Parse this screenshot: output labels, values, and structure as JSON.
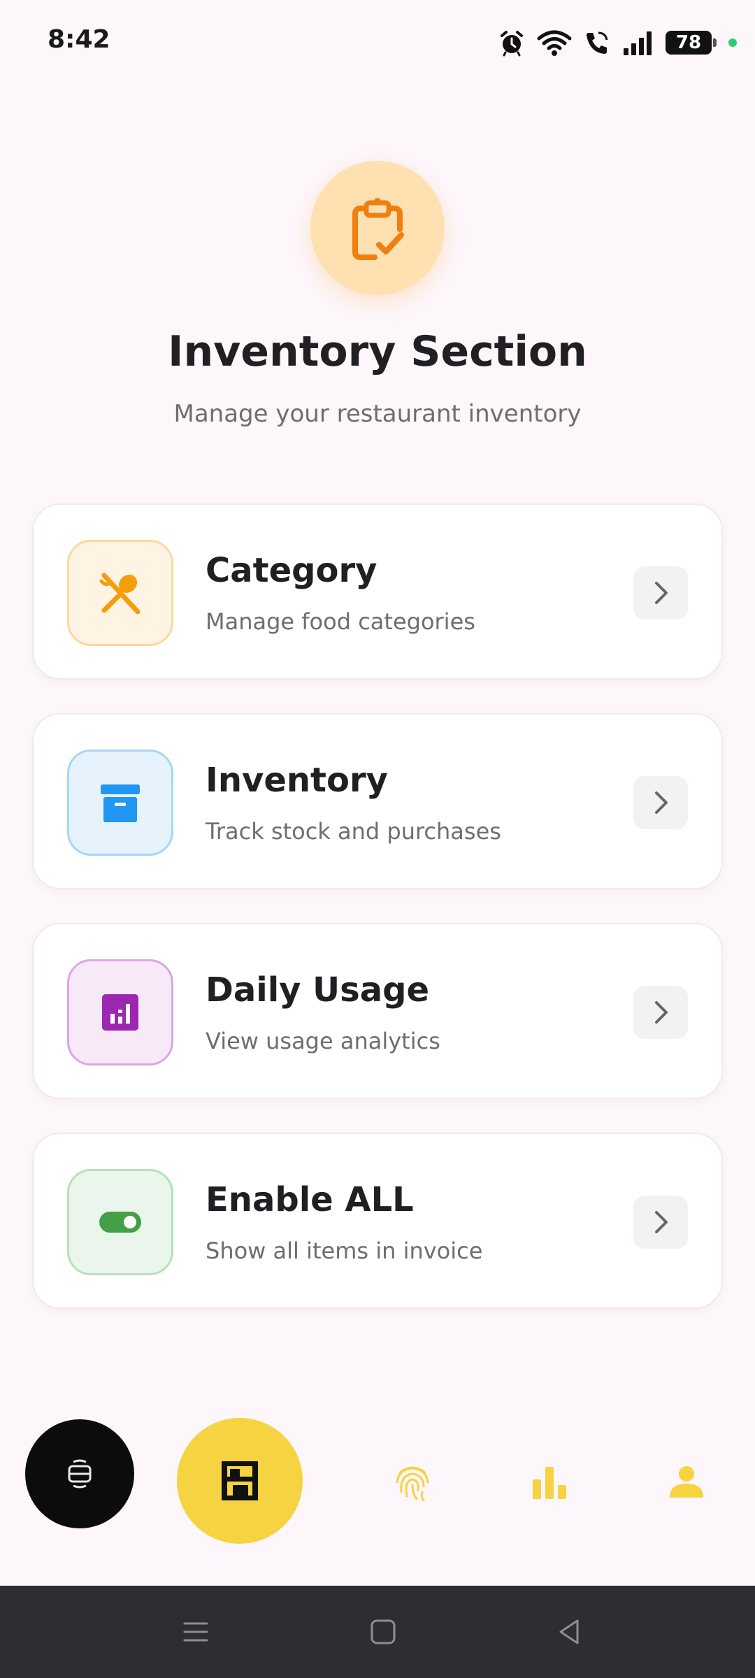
{
  "status_bar": {
    "time": "8:42",
    "battery": "78",
    "icons": [
      "alarm-icon",
      "wifi-icon",
      "wifi-call-icon",
      "signal-icon",
      "battery-icon"
    ]
  },
  "header": {
    "icon": "clipboard-check-icon",
    "title": "Inventory Section",
    "subtitle": "Manage your restaurant inventory"
  },
  "menu": [
    {
      "title": "Category",
      "description": "Manage food categories",
      "icon": "fork-spoon-icon",
      "accent": "#f59e0b",
      "bg": "#fff4e3",
      "border": "#fbd9a0"
    },
    {
      "title": "Inventory",
      "description": "Track stock and purchases",
      "icon": "archive-box-icon",
      "accent": "#2196f3",
      "bg": "#e6f3fd",
      "border": "#a9d5f5"
    },
    {
      "title": "Daily Usage",
      "description": "View usage analytics",
      "icon": "analytics-icon",
      "accent": "#9c27b0",
      "bg": "#f7e9f8",
      "border": "#dca6e3"
    },
    {
      "title": "Enable ALL",
      "description": "Show all items in invoice",
      "icon": "toggle-on-icon",
      "accent": "#43a047",
      "bg": "#eaf6eb",
      "border": "#b7e0ba"
    }
  ],
  "bottom_nav": {
    "items": [
      "scan-icon",
      "shelves-icon",
      "fingerprint-icon",
      "bar-chart-icon",
      "person-icon"
    ],
    "active": "shelves-icon",
    "accent": "#f5d341"
  },
  "system_nav": [
    "menu-icon",
    "home-icon",
    "back-icon"
  ]
}
